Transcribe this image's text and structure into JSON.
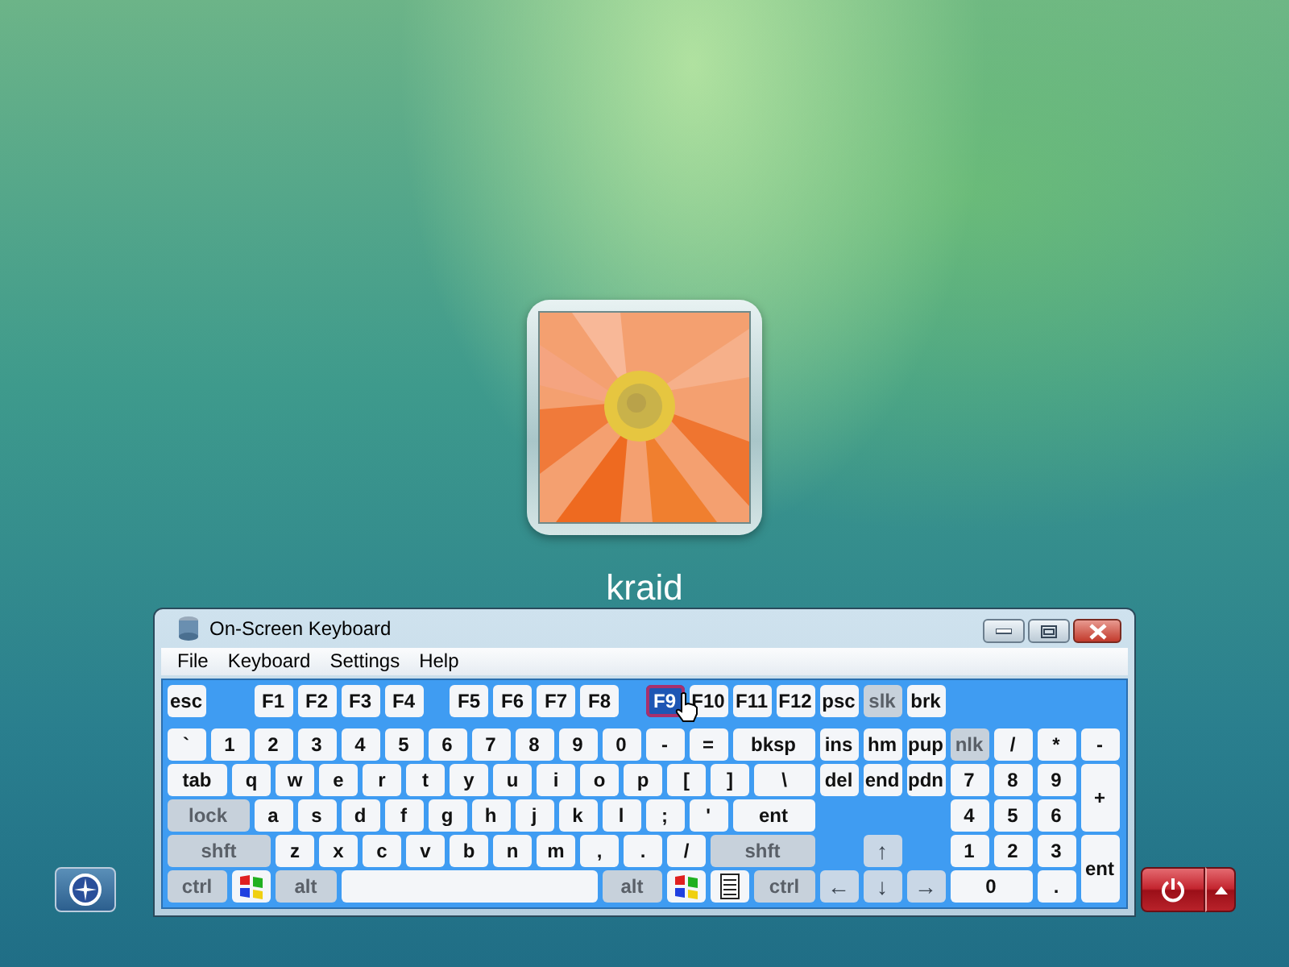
{
  "login": {
    "user_name": "kraid"
  },
  "window": {
    "title": "On-Screen Keyboard",
    "menu": [
      "File",
      "Keyboard",
      "Settings",
      "Help"
    ],
    "rows": [
      {
        "keys": [
          {
            "label": "esc",
            "kind": "char",
            "highlighted": false
          },
          {
            "label": "F1",
            "kind": "char",
            "highlighted": false
          },
          {
            "label": "F2",
            "kind": "char",
            "highlighted": false
          },
          {
            "label": "F3",
            "kind": "char",
            "highlighted": false
          },
          {
            "label": "F4",
            "kind": "char",
            "highlighted": false
          },
          {
            "label": "F5",
            "kind": "char",
            "highlighted": false
          },
          {
            "label": "F6",
            "kind": "char",
            "highlighted": false
          },
          {
            "label": "F7",
            "kind": "char",
            "highlighted": false
          },
          {
            "label": "F8",
            "kind": "char",
            "highlighted": false
          },
          {
            "label": "F9",
            "kind": "char",
            "highlighted": true
          },
          {
            "label": "F10",
            "kind": "char",
            "highlighted": false
          },
          {
            "label": "F11",
            "kind": "char",
            "highlighted": false
          },
          {
            "label": "F12",
            "kind": "char",
            "highlighted": false
          },
          {
            "label": "psc",
            "kind": "char",
            "highlighted": false
          },
          {
            "label": "slk",
            "kind": "modifier",
            "highlighted": false
          },
          {
            "label": "brk",
            "kind": "char",
            "highlighted": false
          }
        ]
      },
      {
        "keys": [
          {
            "label": "`",
            "kind": "char",
            "highlighted": false
          },
          {
            "label": "1",
            "kind": "char",
            "highlighted": false
          },
          {
            "label": "2",
            "kind": "char",
            "highlighted": false
          },
          {
            "label": "3",
            "kind": "char",
            "highlighted": false
          },
          {
            "label": "4",
            "kind": "char",
            "highlighted": false
          },
          {
            "label": "5",
            "kind": "char",
            "highlighted": false
          },
          {
            "label": "6",
            "kind": "char",
            "highlighted": false
          },
          {
            "label": "7",
            "kind": "char",
            "highlighted": false
          },
          {
            "label": "8",
            "kind": "char",
            "highlighted": false
          },
          {
            "label": "9",
            "kind": "char",
            "highlighted": false
          },
          {
            "label": "0",
            "kind": "char",
            "highlighted": false
          },
          {
            "label": "-",
            "kind": "char",
            "highlighted": false
          },
          {
            "label": "=",
            "kind": "char",
            "highlighted": false
          },
          {
            "label": "bksp",
            "kind": "char",
            "highlighted": false
          },
          {
            "label": "ins",
            "kind": "char",
            "highlighted": false
          },
          {
            "label": "hm",
            "kind": "char",
            "highlighted": false
          },
          {
            "label": "pup",
            "kind": "char",
            "highlighted": false
          },
          {
            "label": "nlk",
            "kind": "modifier",
            "highlighted": false
          },
          {
            "label": "/",
            "kind": "char",
            "highlighted": false
          },
          {
            "label": "*",
            "kind": "char",
            "highlighted": false
          },
          {
            "label": "-",
            "kind": "char",
            "highlighted": false
          }
        ]
      },
      {
        "keys": [
          {
            "label": "tab",
            "kind": "char",
            "highlighted": false
          },
          {
            "label": "q",
            "kind": "char",
            "highlighted": false
          },
          {
            "label": "w",
            "kind": "char",
            "highlighted": false
          },
          {
            "label": "e",
            "kind": "char",
            "highlighted": false
          },
          {
            "label": "r",
            "kind": "char",
            "highlighted": false
          },
          {
            "label": "t",
            "kind": "char",
            "highlighted": false
          },
          {
            "label": "y",
            "kind": "char",
            "highlighted": false
          },
          {
            "label": "u",
            "kind": "char",
            "highlighted": false
          },
          {
            "label": "i",
            "kind": "char",
            "highlighted": false
          },
          {
            "label": "o",
            "kind": "char",
            "highlighted": false
          },
          {
            "label": "p",
            "kind": "char",
            "highlighted": false
          },
          {
            "label": "[",
            "kind": "char",
            "highlighted": false
          },
          {
            "label": "]",
            "kind": "char",
            "highlighted": false
          },
          {
            "label": "\\",
            "kind": "char",
            "highlighted": false
          },
          {
            "label": "del",
            "kind": "char",
            "highlighted": false
          },
          {
            "label": "end",
            "kind": "char",
            "highlighted": false
          },
          {
            "label": "pdn",
            "kind": "char",
            "highlighted": false
          },
          {
            "label": "7",
            "kind": "char",
            "highlighted": false
          },
          {
            "label": "8",
            "kind": "char",
            "highlighted": false
          },
          {
            "label": "9",
            "kind": "char",
            "highlighted": false
          },
          {
            "label": "+",
            "kind": "char",
            "highlighted": false
          }
        ]
      },
      {
        "keys": [
          {
            "label": "lock",
            "kind": "modifier",
            "highlighted": false
          },
          {
            "label": "a",
            "kind": "char",
            "highlighted": false
          },
          {
            "label": "s",
            "kind": "char",
            "highlighted": false
          },
          {
            "label": "d",
            "kind": "char",
            "highlighted": false
          },
          {
            "label": "f",
            "kind": "char",
            "highlighted": false
          },
          {
            "label": "g",
            "kind": "char",
            "highlighted": false
          },
          {
            "label": "h",
            "kind": "char",
            "highlighted": false
          },
          {
            "label": "j",
            "kind": "char",
            "highlighted": false
          },
          {
            "label": "k",
            "kind": "char",
            "highlighted": false
          },
          {
            "label": "l",
            "kind": "char",
            "highlighted": false
          },
          {
            "label": ";",
            "kind": "char",
            "highlighted": false
          },
          {
            "label": "'",
            "kind": "char",
            "highlighted": false
          },
          {
            "label": "ent",
            "kind": "char",
            "highlighted": false
          },
          {
            "label": "4",
            "kind": "char",
            "highlighted": false
          },
          {
            "label": "5",
            "kind": "char",
            "highlighted": false
          },
          {
            "label": "6",
            "kind": "char",
            "highlighted": false
          }
        ]
      },
      {
        "keys": [
          {
            "label": "shft",
            "kind": "modifier",
            "highlighted": false
          },
          {
            "label": "z",
            "kind": "char",
            "highlighted": false
          },
          {
            "label": "x",
            "kind": "char",
            "highlighted": false
          },
          {
            "label": "c",
            "kind": "char",
            "highlighted": false
          },
          {
            "label": "v",
            "kind": "char",
            "highlighted": false
          },
          {
            "label": "b",
            "kind": "char",
            "highlighted": false
          },
          {
            "label": "n",
            "kind": "char",
            "highlighted": false
          },
          {
            "label": "m",
            "kind": "char",
            "highlighted": false
          },
          {
            "label": ",",
            "kind": "char",
            "highlighted": false
          },
          {
            "label": ".",
            "kind": "char",
            "highlighted": false
          },
          {
            "label": "/",
            "kind": "char",
            "highlighted": false
          },
          {
            "label": "shft",
            "kind": "modifier",
            "highlighted": false
          },
          {
            "label": "↑",
            "kind": "arrow",
            "highlighted": false
          },
          {
            "label": "1",
            "kind": "char",
            "highlighted": false
          },
          {
            "label": "2",
            "kind": "char",
            "highlighted": false
          },
          {
            "label": "3",
            "kind": "char",
            "highlighted": false
          },
          {
            "label": "ent",
            "kind": "char",
            "highlighted": false
          }
        ]
      },
      {
        "keys": [
          {
            "label": "ctrl",
            "kind": "modifier",
            "highlighted": false
          },
          {
            "kind": "windows",
            "highlighted": false
          },
          {
            "label": "alt",
            "kind": "modifier",
            "highlighted": false
          },
          {
            "kind": "space",
            "highlighted": false
          },
          {
            "label": "alt",
            "kind": "modifier",
            "highlighted": false
          },
          {
            "kind": "windows",
            "highlighted": false
          },
          {
            "kind": "menu",
            "highlighted": false
          },
          {
            "label": "ctrl",
            "kind": "modifier",
            "highlighted": false
          },
          {
            "label": "←",
            "kind": "arrow",
            "highlighted": false
          },
          {
            "label": "↓",
            "kind": "arrow",
            "highlighted": false
          },
          {
            "label": "→",
            "kind": "arrow",
            "highlighted": false
          },
          {
            "label": "0",
            "kind": "char",
            "highlighted": false
          },
          {
            "label": ".",
            "kind": "char",
            "highlighted": false
          }
        ]
      }
    ]
  }
}
